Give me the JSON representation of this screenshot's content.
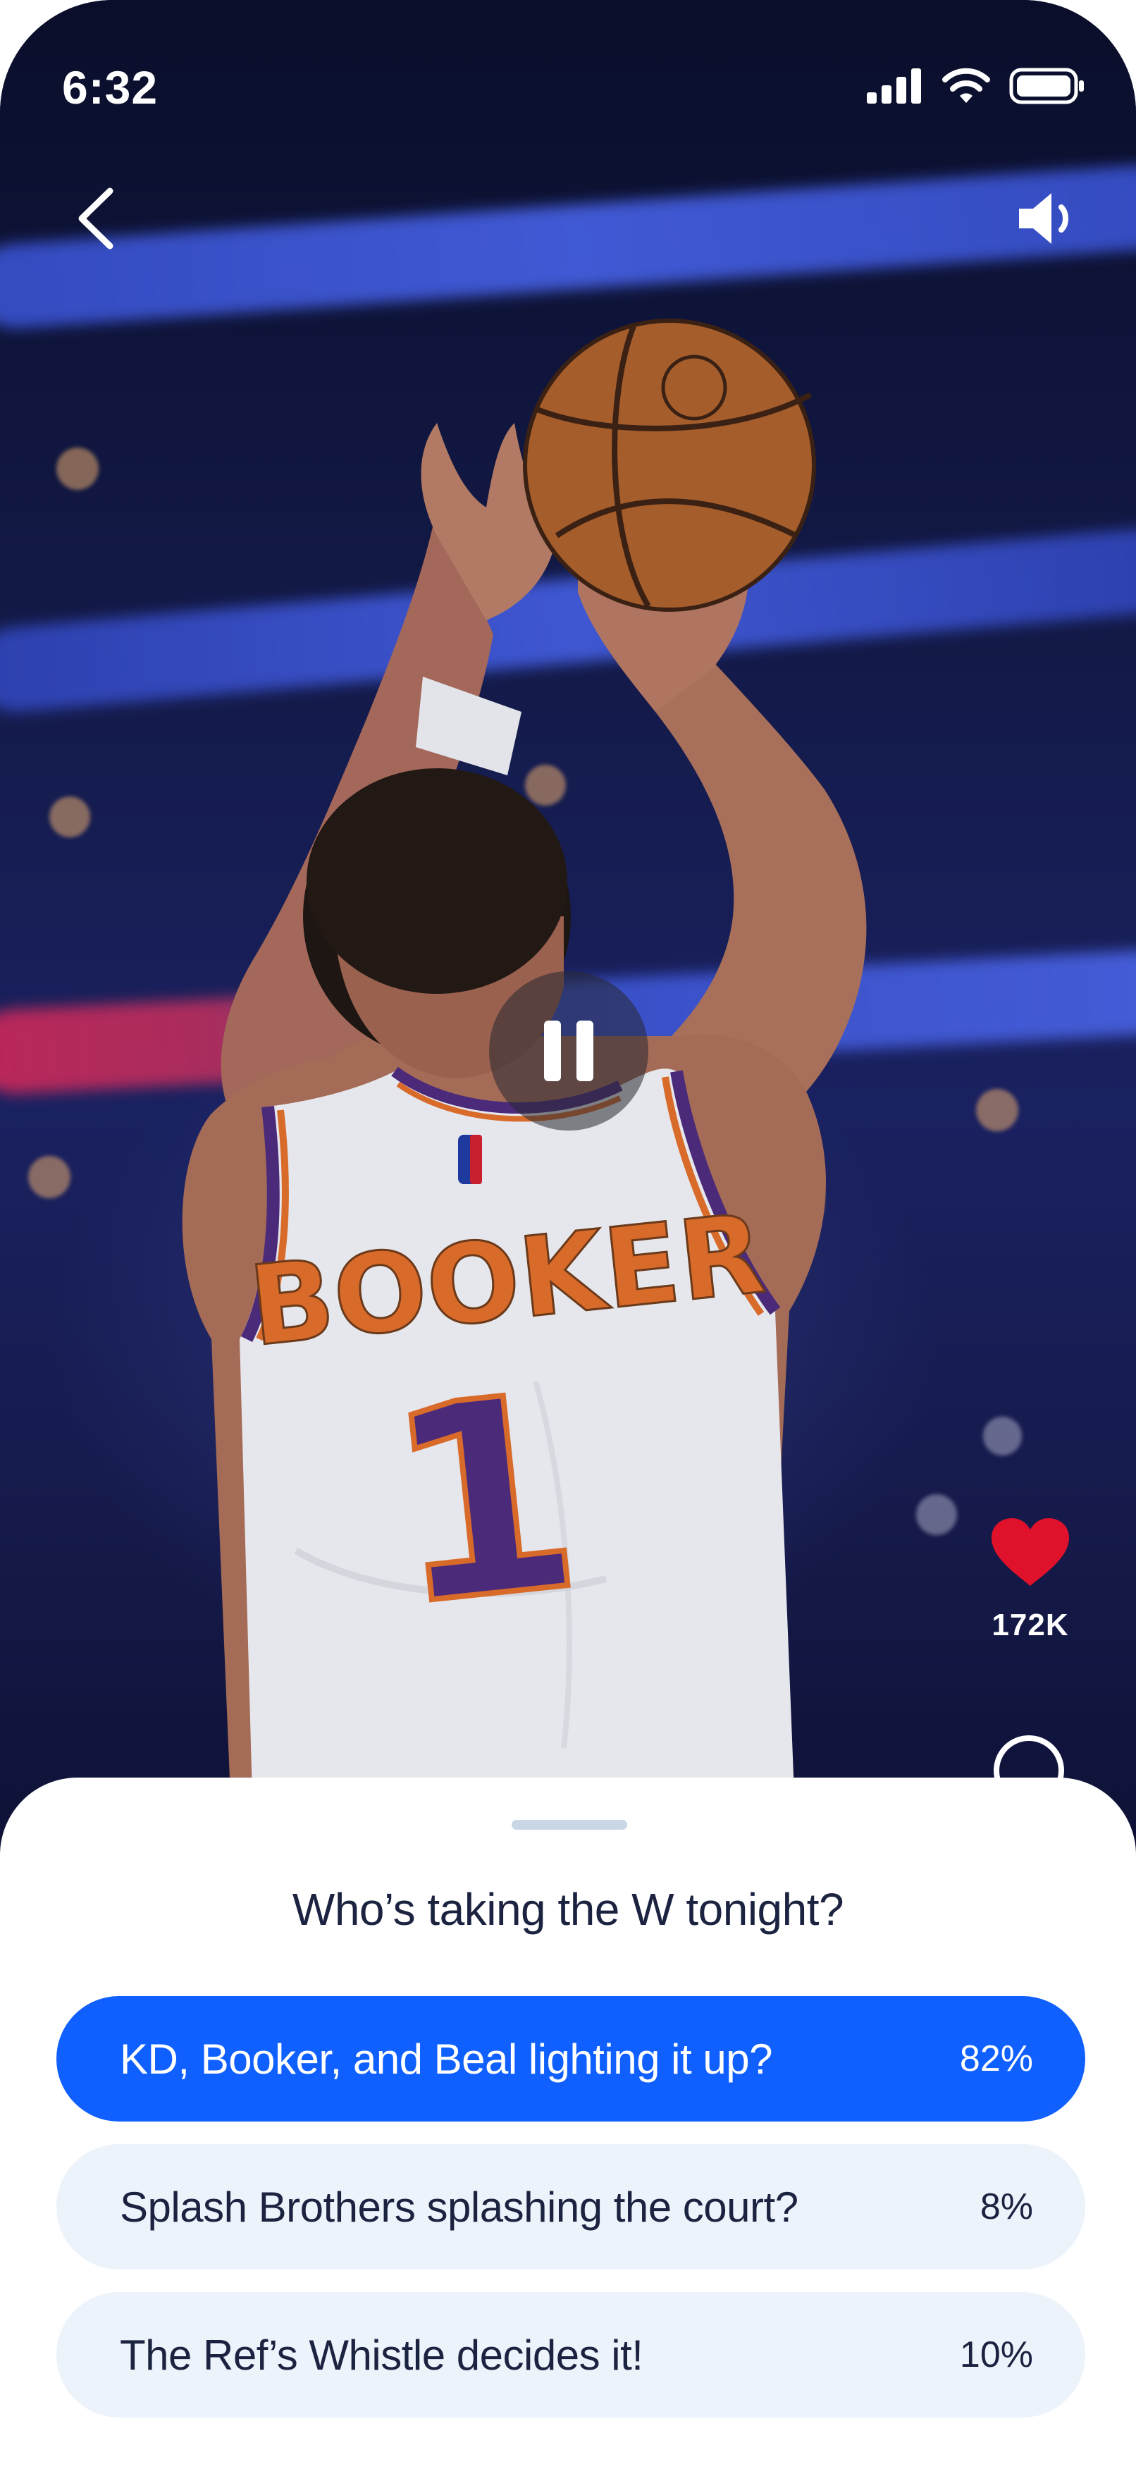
{
  "status_bar": {
    "time": "6:32",
    "icons": [
      "cellular-signal-icon",
      "wifi-icon",
      "battery-icon"
    ]
  },
  "video": {
    "jersey_name": "BOOKER",
    "jersey_number": "1",
    "controls": [
      "back-chevron-icon",
      "volume-icon",
      "pause-icon"
    ]
  },
  "actions": {
    "likes": "172K",
    "like_icon": "heart-icon",
    "comment_icon": "comment-icon"
  },
  "poll": {
    "question": "Who’s taking the W tonight?",
    "options": [
      {
        "label": "KD, Booker, and Beal lighting it up?",
        "percent": "82%",
        "selected": true
      },
      {
        "label": "Splash Brothers splashing the court?",
        "percent": "8%",
        "selected": false
      },
      {
        "label": "The Ref’s Whistle decides it!",
        "percent": "10%",
        "selected": false
      }
    ]
  },
  "colors": {
    "accent": "#0f60ff",
    "option_bg": "#edf3fb",
    "text_dark": "#1b2340",
    "heart": "#e0112b",
    "jersey_lettering": "#d86a2a",
    "jersey_trim": "#4b2a7a"
  }
}
